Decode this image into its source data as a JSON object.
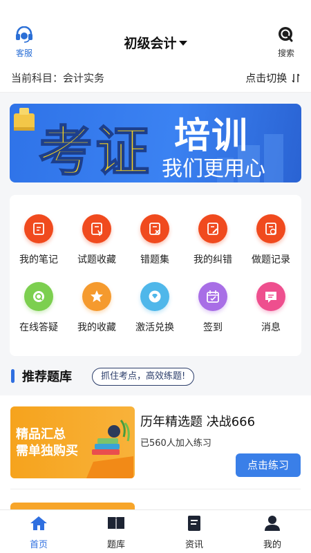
{
  "header": {
    "service_label": "客服",
    "title": "初级会计",
    "search_label": "搜索"
  },
  "subject_bar": {
    "current_subject": "当前科目：会计实务",
    "switch_label": "点击切换"
  },
  "banner": {
    "line1": "考证",
    "line2": "培训",
    "line3": "我们更用心"
  },
  "grid": [
    {
      "label": "我的笔记",
      "icon": "note-icon",
      "color": "#f04a1e"
    },
    {
      "label": "试题收藏",
      "icon": "question-favorite-icon",
      "color": "#f04a1e"
    },
    {
      "label": "错题集",
      "icon": "wrong-questions-icon",
      "color": "#f04a1e"
    },
    {
      "label": "我的纠错",
      "icon": "correction-icon",
      "color": "#f04a1e"
    },
    {
      "label": "做题记录",
      "icon": "practice-record-icon",
      "color": "#f04a1e"
    },
    {
      "label": "在线答疑",
      "icon": "online-qa-icon",
      "color": "#7ccf4f"
    },
    {
      "label": "我的收藏",
      "icon": "star-icon",
      "color": "#f59a2e"
    },
    {
      "label": "激活兑换",
      "icon": "diamond-icon",
      "color": "#4fb7ea"
    },
    {
      "label": "签到",
      "icon": "calendar-icon",
      "color": "#a86ee6"
    },
    {
      "label": "消息",
      "icon": "message-icon",
      "color": "#ee4f8e"
    }
  ],
  "recommend": {
    "heading": "推荐题库",
    "tag": "抓住考点，高效练题!"
  },
  "course": {
    "thumb_line1": "精品汇总",
    "thumb_line2": "需单独购买",
    "title": "历年精选题 决战666",
    "count": "已560人加入练习",
    "button": "点击练习"
  },
  "tabs": [
    {
      "label": "首页",
      "icon": "home-icon",
      "active": true
    },
    {
      "label": "题库",
      "icon": "book-icon",
      "active": false
    },
    {
      "label": "资讯",
      "icon": "news-icon",
      "active": false
    },
    {
      "label": "我的",
      "icon": "user-icon",
      "active": false
    }
  ],
  "colors": {
    "accent": "#2f6fe0",
    "button": "#3a7fe8",
    "banner_text": "#f5d21f"
  }
}
